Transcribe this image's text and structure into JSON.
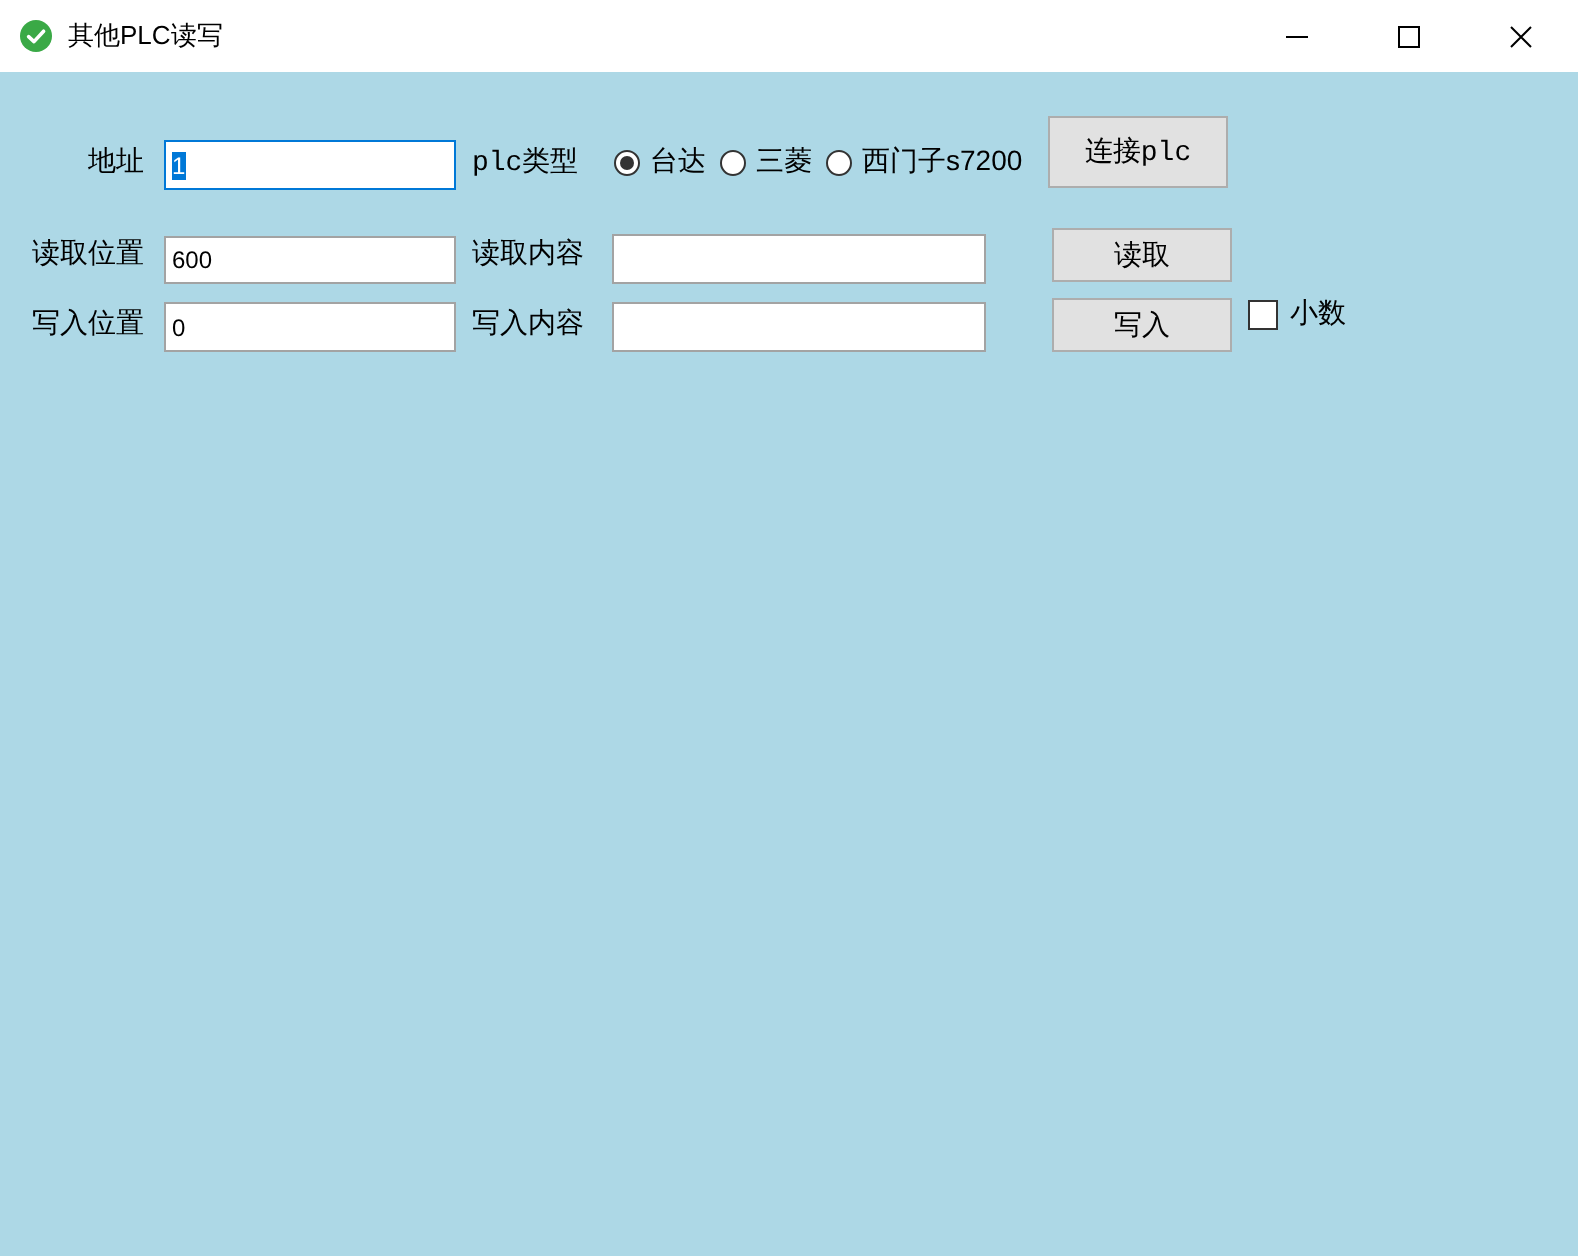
{
  "window": {
    "title": "其他PLC读写"
  },
  "address": {
    "label": "地址",
    "value": "1",
    "focused": true
  },
  "plc_type": {
    "label": "plc类型",
    "options": [
      {
        "label": "台达",
        "selected": true
      },
      {
        "label": "三菱",
        "selected": false
      },
      {
        "label": "西门子s7200",
        "selected": false
      }
    ]
  },
  "connect_button": {
    "label": "连接plc"
  },
  "read": {
    "position_label": "读取位置",
    "position_value": "600",
    "content_label": "读取内容",
    "button": "读取"
  },
  "write": {
    "position_label": "写入位置",
    "position_value": "0",
    "content_label": "写入内容",
    "button": "写入"
  },
  "decimal": {
    "label": "小数",
    "checked": false
  }
}
